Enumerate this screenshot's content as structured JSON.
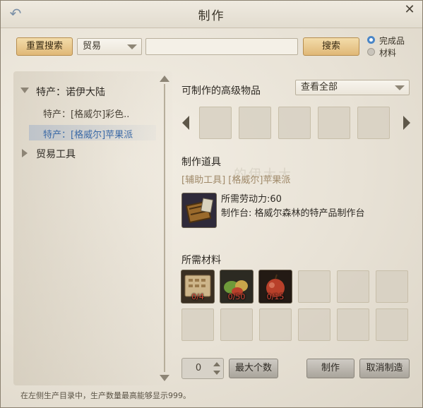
{
  "window": {
    "title": "制作"
  },
  "toolbar": {
    "reset_label": "重置搜索",
    "category_select": "贸易",
    "search_value": "",
    "search_label": "搜索",
    "radio_finished": "完成品",
    "radio_material": "材料",
    "selected_radio": "完成品"
  },
  "tree": {
    "group1": "特产：诺伊大陆",
    "item1": "特产：[格威尔]彩色..",
    "item2": "特产：[格威尔]苹果派",
    "group2": "贸易工具"
  },
  "craftable": {
    "heading": "可制作的高级物品",
    "filter": "查看全部"
  },
  "tool": {
    "heading": "制作道具",
    "name": "[辅助工具] [格威尔]苹果派",
    "labor": "所需劳动力:60",
    "bench": "制作台: 格威尔森林的特产品制作台"
  },
  "materials": {
    "heading": "所需材料",
    "items": [
      {
        "icon": "scroll-icon",
        "qty": "0/4"
      },
      {
        "icon": "vegetables-icon",
        "qty": "0/50"
      },
      {
        "icon": "apple-icon",
        "qty": "0/15"
      }
    ]
  },
  "actions": {
    "quantity": "0",
    "max_label": "最大个数",
    "craft_label": "制作",
    "cancel_label": "取消制造"
  },
  "footer": {
    "note": "在左侧生产目录中，生产数量最高能够显示999。"
  },
  "colors": {
    "accent": "#e0b877",
    "selected_text": "#3c6aa6",
    "qty_text": "#d84a3a"
  }
}
